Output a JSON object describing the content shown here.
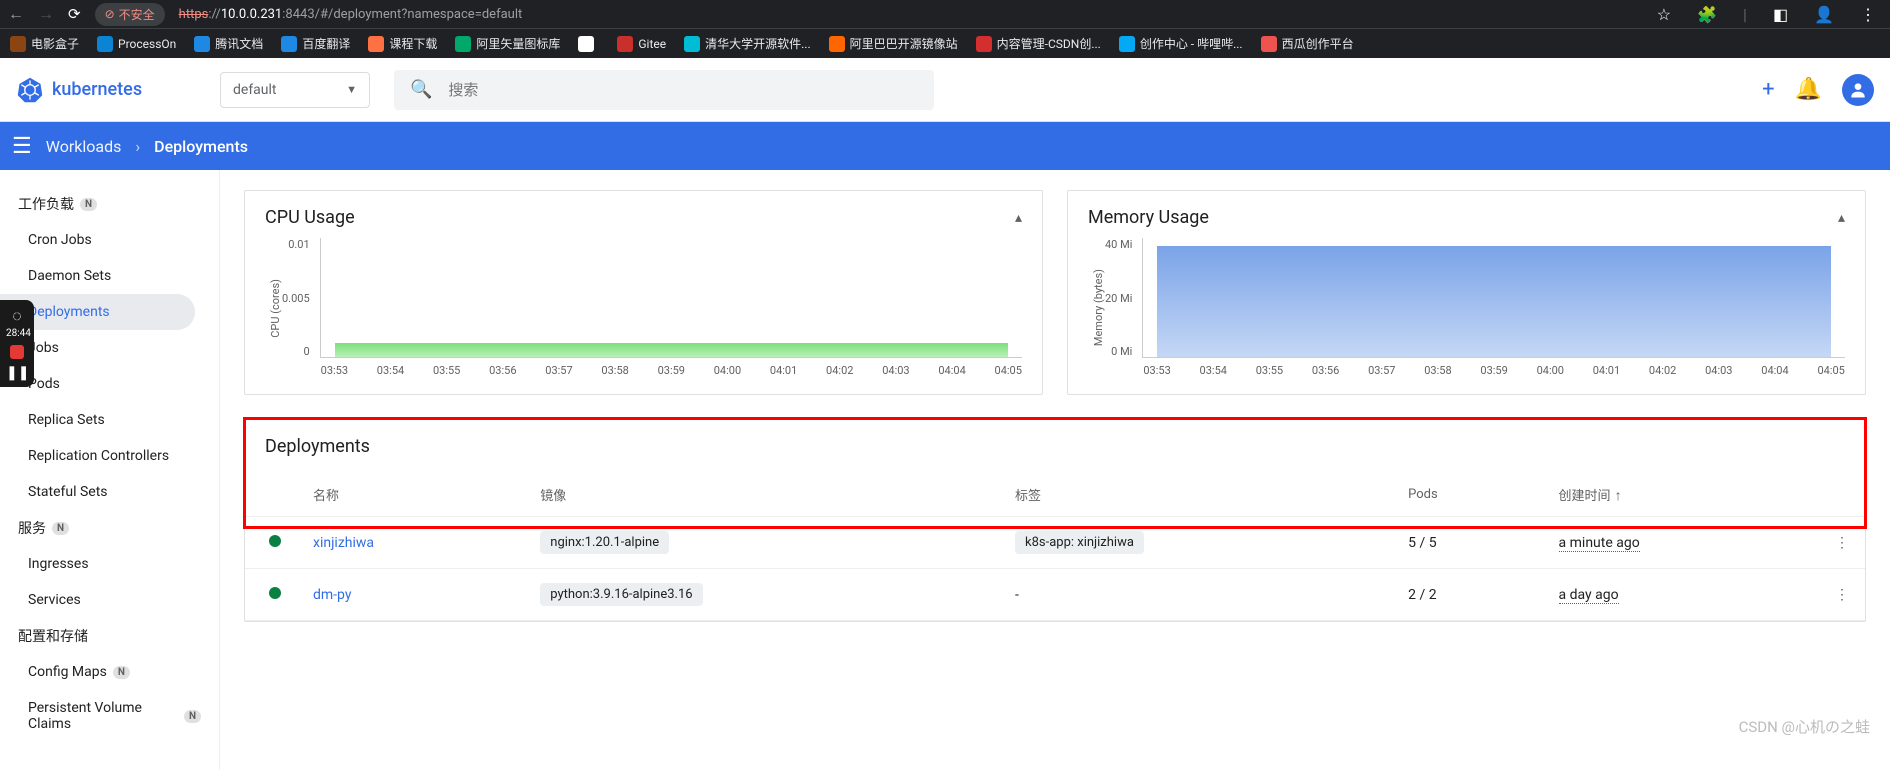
{
  "browser": {
    "warn_text": "不安全",
    "url_proto": "https",
    "url_rest1": "://",
    "url_host": "10.0.0.231",
    "url_rest2": ":8443/#/deployment?namespace=default",
    "bookmarks": [
      "电影盒子",
      "ProcessOn",
      "腾讯文档",
      "百度翻译",
      "课程下载",
      "阿里矢量图标库",
      "",
      "Gitee",
      "清华大学开源软件...",
      "阿里巴巴开源镜像站",
      "内容管理-CSDN创...",
      "创作中心 - 哔哩哔...",
      "西瓜创作平台"
    ],
    "bm_colors": [
      "#8b4513",
      "#0b84d4",
      "#1e88e5",
      "#1e88e5",
      "#ff7043",
      "#00a86b",
      "#fff",
      "#c9302c",
      "#00bcd4",
      "#ff6600",
      "#d32f2f",
      "#03a9f4",
      "#ef5350"
    ]
  },
  "header": {
    "brand": "kubernetes",
    "namespace": "default",
    "search_placeholder": "搜索"
  },
  "breadcrumb": {
    "first": "Workloads",
    "second": "Deployments"
  },
  "sidebar": {
    "group1": "工作负载",
    "items1": [
      "Cron Jobs",
      "Daemon Sets",
      "Deployments",
      "Jobs",
      "Pods",
      "Replica Sets",
      "Replication Controllers",
      "Stateful Sets"
    ],
    "active_index": 2,
    "group2": "服务",
    "items2": [
      "Ingresses",
      "Services"
    ],
    "group3": "配置和存储",
    "items3": [
      "Config Maps",
      "Persistent Volume Claims"
    ],
    "badge3": [
      true,
      true
    ]
  },
  "charts": {
    "cpu_title": "CPU Usage",
    "mem_title": "Memory Usage",
    "cpu_ylabel": "CPU (cores)",
    "mem_ylabel": "Memory (bytes)",
    "cpu_yticks": [
      "0.01",
      "0.005",
      "0"
    ],
    "mem_yticks": [
      "40 Mi",
      "20 Mi",
      "0 Mi"
    ],
    "xticks": [
      "03:53",
      "03:54",
      "03:55",
      "03:56",
      "03:57",
      "03:58",
      "03:59",
      "04:00",
      "04:01",
      "04:02",
      "04:03",
      "04:04",
      "04:05"
    ]
  },
  "chart_data": [
    {
      "type": "area",
      "title": "CPU Usage",
      "ylabel": "CPU (cores)",
      "ylim": [
        0,
        0.012
      ],
      "x": [
        "03:53",
        "03:54",
        "03:55",
        "03:56",
        "03:57",
        "03:58",
        "03:59",
        "04:00",
        "04:01",
        "04:02",
        "04:03",
        "04:04",
        "04:05"
      ],
      "values": [
        0.002,
        0.002,
        0.002,
        0.002,
        0.002,
        0.002,
        0.002,
        0.002,
        0.002,
        0.002,
        0.002,
        0.002,
        0.002
      ]
    },
    {
      "type": "area",
      "title": "Memory Usage",
      "ylabel": "Memory (bytes)",
      "ylim": [
        0,
        45
      ],
      "x": [
        "03:53",
        "03:54",
        "03:55",
        "03:56",
        "03:57",
        "03:58",
        "03:59",
        "04:00",
        "04:01",
        "04:02",
        "04:03",
        "04:04",
        "04:05"
      ],
      "values": [
        37,
        37,
        37,
        37,
        37,
        37,
        37,
        37,
        37,
        37,
        37,
        37,
        37
      ],
      "unit": "Mi"
    }
  ],
  "table": {
    "title": "Deployments",
    "columns": [
      "名称",
      "镜像",
      "标签",
      "Pods",
      "创建时间"
    ],
    "rows": [
      {
        "name": "xinjizhiwa",
        "image": "nginx:1.20.1-alpine",
        "labels": "k8s-app: xinjizhiwa",
        "pods": "5 / 5",
        "created": "a minute ago"
      },
      {
        "name": "dm-py",
        "image": "python:3.9.16-alpine3.16",
        "labels": "-",
        "pods": "2 / 2",
        "created": "a day ago"
      }
    ]
  },
  "float": {
    "time": "28:44"
  },
  "watermark": "CSDN @心机の之蛙"
}
